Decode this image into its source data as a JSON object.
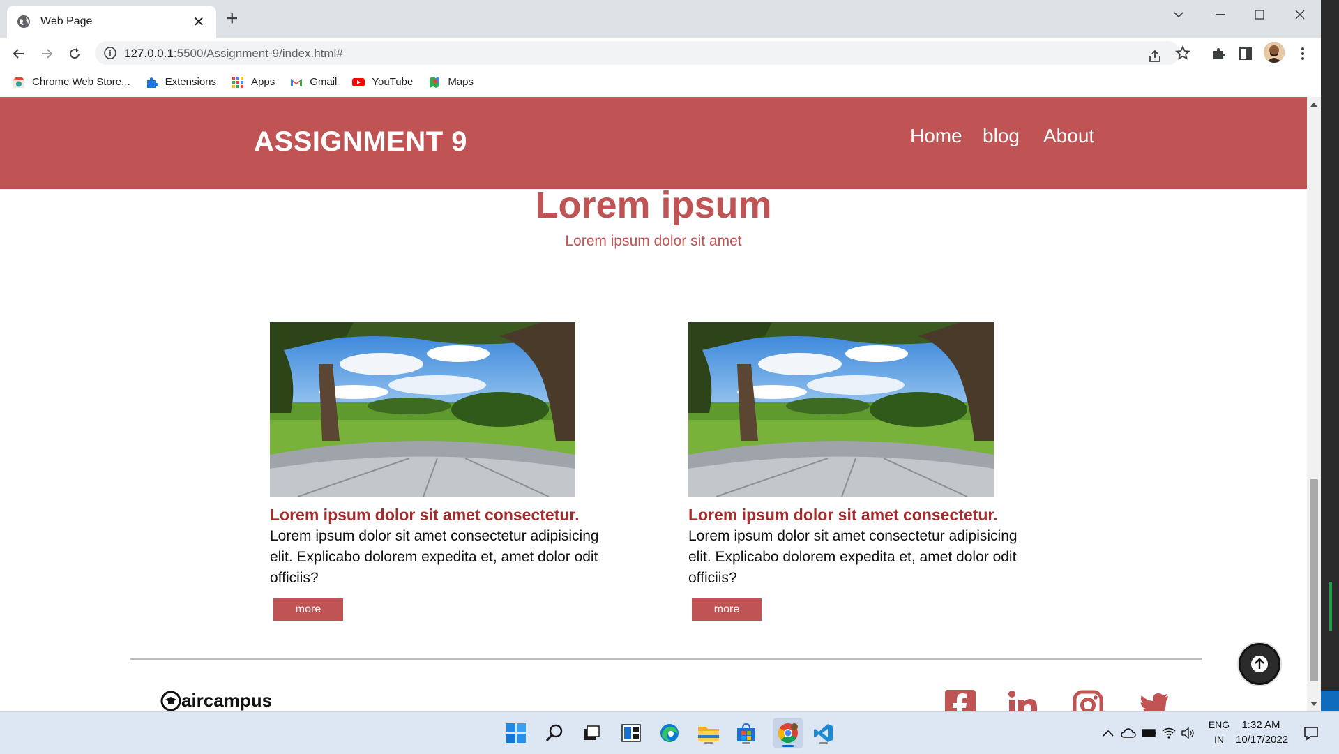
{
  "browser": {
    "tab_title": "Web Page",
    "url_host": "127.0.0.1",
    "url_rest": ":5500/Assignment-9/index.html#",
    "bookmarks": [
      {
        "label": "Chrome Web Store...",
        "icon": "chrome-web-store-icon"
      },
      {
        "label": "Extensions",
        "icon": "puzzle-icon"
      },
      {
        "label": "Apps",
        "icon": "apps-grid-icon"
      },
      {
        "label": "Gmail",
        "icon": "gmail-icon"
      },
      {
        "label": "YouTube",
        "icon": "youtube-icon"
      },
      {
        "label": "Maps",
        "icon": "maps-icon"
      }
    ]
  },
  "site": {
    "brand": "ASSIGNMENT 9",
    "nav": [
      {
        "label": "Home"
      },
      {
        "label": "blog"
      },
      {
        "label": "About"
      }
    ],
    "hero_title": "Lorem ipsum",
    "hero_subtitle": "Lorem ipsum dolor sit amet",
    "cards": [
      {
        "title": "Lorem ipsum dolor sit amet consectetur.",
        "text": "Lorem ipsum dolor sit amet consectetur adipisicing elit. Explicabo dolorem expedita et, amet dolor odit officiis?",
        "button": "more"
      },
      {
        "title": "Lorem ipsum dolor sit amet consectetur.",
        "text": "Lorem ipsum dolor sit amet consectetur adipisicing elit. Explicabo dolorem expedita et, amet dolor odit officiis?",
        "button": "more"
      }
    ],
    "footer_logo": "aircampus",
    "social": [
      "facebook-icon",
      "linkedin-icon",
      "instagram-icon",
      "twitter-icon"
    ]
  },
  "taskbar": {
    "lang_top": "ENG",
    "lang_bottom": "IN",
    "time": "1:32 AM",
    "date": "10/17/2022"
  },
  "colors": {
    "brand_red": "#c05454",
    "title_red": "#a52a2a"
  }
}
